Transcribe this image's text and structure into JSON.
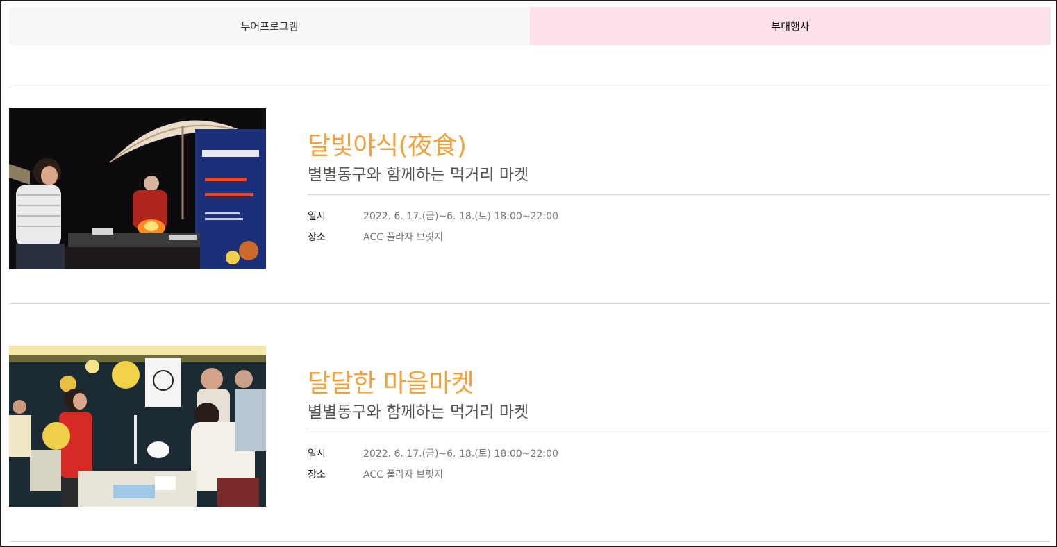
{
  "tabs": [
    {
      "label": "투어프로그램",
      "active": false
    },
    {
      "label": "부대행사",
      "active": true
    }
  ],
  "events": [
    {
      "title": "달빛야식(夜食)",
      "subtitle": "별별동구와 함께하는 먹거리 마켓",
      "date_label": "일시",
      "date_value": "2022. 6. 17.(금)~6. 18.(토) 18:00~22:00",
      "place_label": "장소",
      "place_value": "ACC 플라자 브릿지",
      "image_alt": "야간 먹거리 마켓 사진"
    },
    {
      "title": "달달한 마을마켓",
      "subtitle": "별별동구와 함께하는 먹거리 마켓",
      "date_label": "일시",
      "date_value": "2022. 6. 17.(금)~6. 18.(토) 18:00~22:00",
      "place_label": "장소",
      "place_value": "ACC 플라자 브릿지",
      "image_alt": "마을마켓 부스 사진"
    }
  ],
  "colors": {
    "accent_title": "#f2a23c",
    "active_tab_bg": "#fde1e8",
    "inactive_tab_bg": "#f7f7f7"
  }
}
